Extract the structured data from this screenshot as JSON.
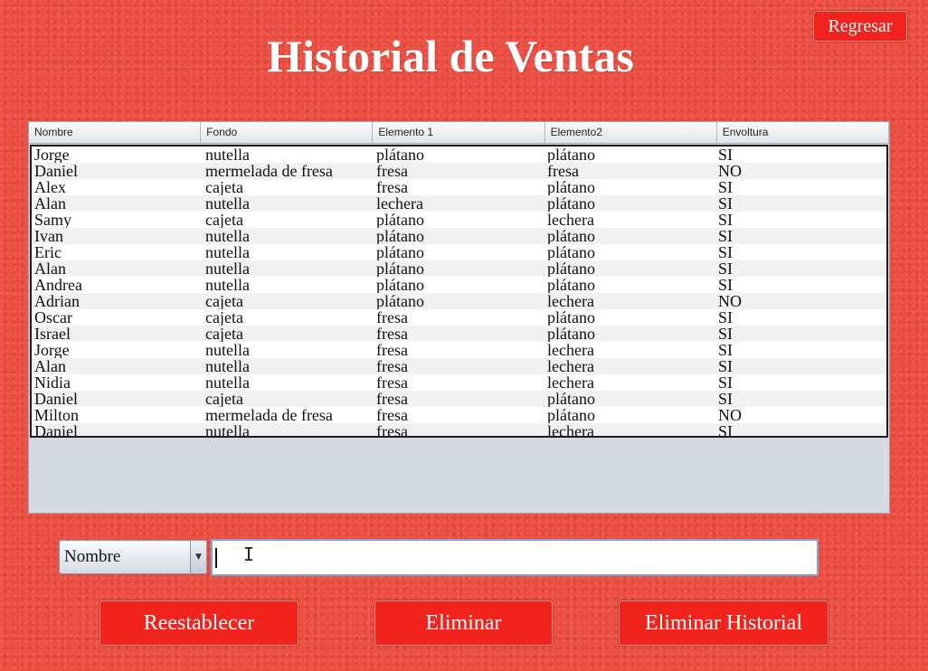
{
  "header": {
    "title": "Historial de Ventas",
    "back_label": "Regresar"
  },
  "table": {
    "columns": [
      "Nombre",
      "Fondo",
      "Elemento 1",
      "Elemento2",
      "Envoltura"
    ],
    "rows": [
      [
        "Jorge",
        "nutella",
        "plátano",
        "plátano",
        "SI"
      ],
      [
        "Daniel",
        "mermelada de fresa",
        "fresa",
        "fresa",
        "NO"
      ],
      [
        "Alex",
        "cajeta",
        "fresa",
        "plátano",
        "SI"
      ],
      [
        "Alan",
        "nutella",
        "lechera",
        "plátano",
        "SI"
      ],
      [
        "Samy",
        "cajeta",
        "plátano",
        "lechera",
        "SI"
      ],
      [
        "Ivan",
        "nutella",
        "plátano",
        "plátano",
        "SI"
      ],
      [
        "Eric",
        "nutella",
        "plátano",
        "plátano",
        "SI"
      ],
      [
        "Alan",
        "nutella",
        "plátano",
        "plátano",
        "SI"
      ],
      [
        "Andrea",
        "nutella",
        "plátano",
        "plátano",
        "SI"
      ],
      [
        "Adrian",
        "cajeta",
        "plátano",
        "lechera",
        "NO"
      ],
      [
        "Oscar",
        "cajeta",
        "fresa",
        "plátano",
        "SI"
      ],
      [
        "Israel",
        "cajeta",
        "fresa",
        "plátano",
        "SI"
      ],
      [
        "Jorge",
        "nutella",
        "fresa",
        "lechera",
        "SI"
      ],
      [
        "Alan",
        "nutella",
        "fresa",
        "lechera",
        "SI"
      ],
      [
        "Nidia",
        "nutella",
        "fresa",
        "lechera",
        "SI"
      ],
      [
        "Daniel",
        "cajeta",
        "fresa",
        "plátano",
        "SI"
      ],
      [
        "Milton",
        "mermelada de fresa",
        "fresa",
        "plátano",
        "NO"
      ],
      [
        "Daniel",
        "nutella",
        "fresa",
        "lechera",
        "SI"
      ]
    ]
  },
  "filter": {
    "field_selected": "Nombre",
    "dropdown_icon": "triangle-down",
    "search_value": ""
  },
  "actions": {
    "reset_label": "Reestablecer",
    "delete_label": "Eliminar",
    "delete_all_label": "Eliminar Historial"
  },
  "colors": {
    "background": "#ee4d3f",
    "button": "#f2231c",
    "panel": "#d5d9e1"
  }
}
